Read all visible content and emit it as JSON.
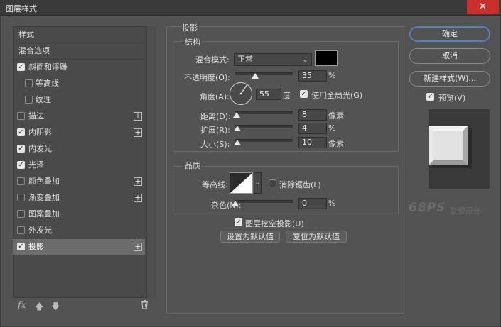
{
  "window": {
    "title": "图层样式",
    "close_glyph": "✕"
  },
  "styles_list": [
    {
      "label": "样式",
      "checkbox": null,
      "plus": false,
      "active": false,
      "indent": false
    },
    {
      "label": "混合选项",
      "checkbox": null,
      "plus": false,
      "active": false,
      "indent": false
    },
    {
      "label": "斜面和浮雕",
      "checkbox": true,
      "plus": false,
      "active": false,
      "indent": false
    },
    {
      "label": "等高线",
      "checkbox": false,
      "plus": false,
      "active": false,
      "indent": true
    },
    {
      "label": "纹理",
      "checkbox": false,
      "plus": false,
      "active": false,
      "indent": true
    },
    {
      "label": "描边",
      "checkbox": false,
      "plus": true,
      "active": false,
      "indent": false
    },
    {
      "label": "内阴影",
      "checkbox": true,
      "plus": true,
      "active": false,
      "indent": false
    },
    {
      "label": "内发光",
      "checkbox": true,
      "plus": false,
      "active": false,
      "indent": false
    },
    {
      "label": "光泽",
      "checkbox": true,
      "plus": false,
      "active": false,
      "indent": false
    },
    {
      "label": "颜色叠加",
      "checkbox": false,
      "plus": true,
      "active": false,
      "indent": false
    },
    {
      "label": "渐变叠加",
      "checkbox": false,
      "plus": true,
      "active": false,
      "indent": false
    },
    {
      "label": "图案叠加",
      "checkbox": false,
      "plus": false,
      "active": false,
      "indent": false
    },
    {
      "label": "外发光",
      "checkbox": false,
      "plus": false,
      "active": false,
      "indent": false
    },
    {
      "label": "投影",
      "checkbox": true,
      "plus": true,
      "active": true,
      "indent": false
    }
  ],
  "toolbar": {
    "fx_label": "fx"
  },
  "shadow": {
    "section_title": "投影",
    "structure": {
      "title": "结构",
      "blend_mode_label": "混合模式:",
      "blend_mode_value": "正常",
      "blend_color": "#000000",
      "opacity_label": "不透明度(O):",
      "opacity_value": "35",
      "opacity_fraction": 0.35,
      "percent": "%",
      "angle_label": "角度(A):",
      "angle_value": "55",
      "degree_unit": "度",
      "global_light_checked": true,
      "global_light_label": "使用全局光(G)",
      "distance_label": "距离(D):",
      "distance_value": "8",
      "distance_fraction": 0.03,
      "pixel_unit": "像素",
      "spread_label": "扩展(R):",
      "spread_value": "4",
      "spread_fraction": 0.04,
      "size_label": "大小(S):",
      "size_value": "10",
      "size_fraction": 0.04
    },
    "quality": {
      "title": "品质",
      "contour_label": "等高线:",
      "antialias_checked": false,
      "antialias_label": "消除锯齿(L)",
      "noise_label": "杂色(N):",
      "noise_value": "0",
      "noise_fraction": 0.0
    },
    "knockout_checked": true,
    "knockout_label": "图层挖空投影(U)",
    "set_default_label": "设置为默认值",
    "reset_default_label": "复位为默认值"
  },
  "right_buttons": {
    "ok": "确定",
    "cancel": "取消",
    "new_style": "新建样式(W)...",
    "preview_checked": true,
    "preview_label": "预览(V)"
  },
  "watermark": {
    "logo": "68PS",
    "text": "联盟原创"
  }
}
